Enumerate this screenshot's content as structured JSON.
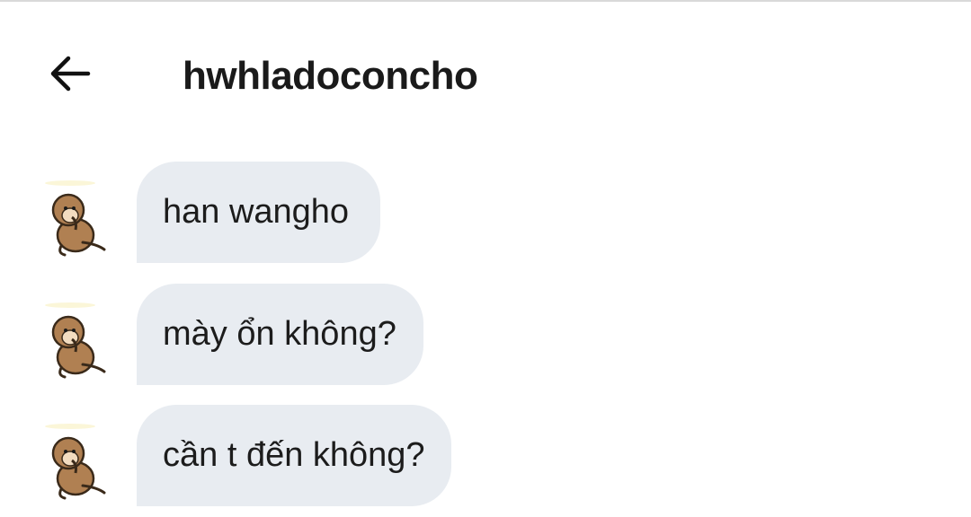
{
  "header": {
    "back_icon": "arrow-left-icon",
    "title": "hwhladoconcho"
  },
  "avatar_icon": "monkey-sticker-icon",
  "messages": [
    {
      "text": "han wangho"
    },
    {
      "text": "mày ổn không?"
    },
    {
      "text": "cần t đến không?"
    }
  ],
  "colors": {
    "bubble_bg": "#e8ecf1",
    "text": "#1c1c1c",
    "background": "#ffffff"
  }
}
